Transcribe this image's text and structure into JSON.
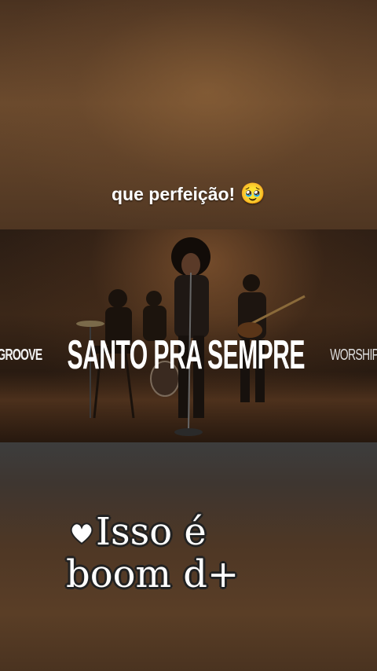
{
  "caption": {
    "text": "que perfeição!",
    "emoji": "🥹"
  },
  "video": {
    "title_left": "GROOVE",
    "title_main": "SANTO PRA SEMPRE",
    "title_right": "WORSHIP"
  },
  "sticker": {
    "line1": "Isso é",
    "line2": "boom d+",
    "icon": "heart-icon"
  }
}
